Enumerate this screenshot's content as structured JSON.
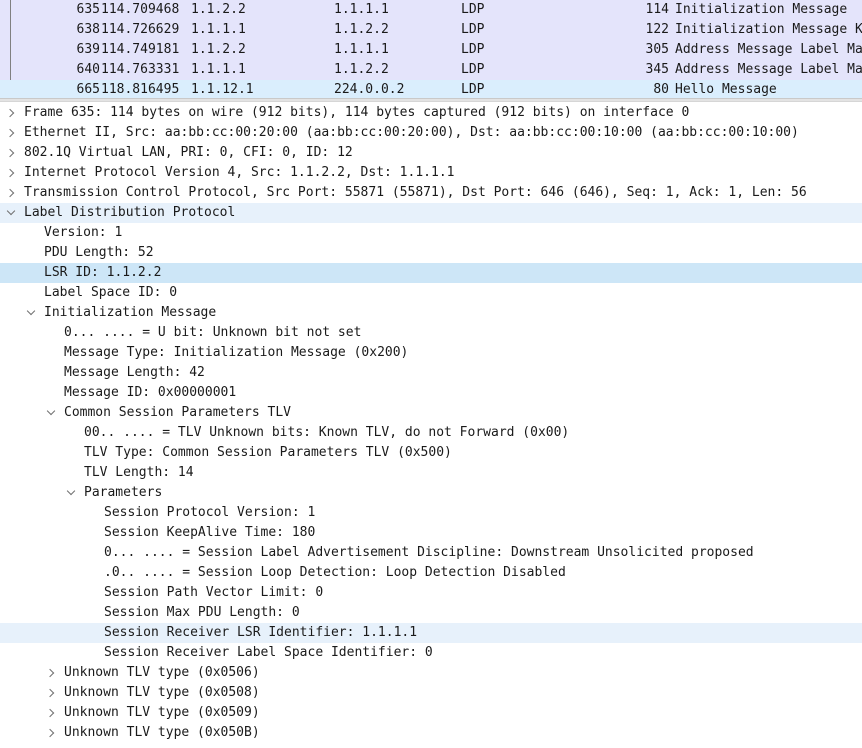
{
  "packet_list": {
    "rows": [
      {
        "no": "635",
        "time": "114.709468",
        "src": "1.1.2.2",
        "dst": "1.1.1.1",
        "proto": "LDP",
        "len": "114",
        "info": "Initialization Message",
        "bg": "#e4e4fb"
      },
      {
        "no": "638",
        "time": "114.726629",
        "src": "1.1.1.1",
        "dst": "1.1.2.2",
        "proto": "LDP",
        "len": "122",
        "info": "Initialization Message K",
        "bg": "#e4e4fb"
      },
      {
        "no": "639",
        "time": "114.749181",
        "src": "1.1.2.2",
        "dst": "1.1.1.1",
        "proto": "LDP",
        "len": "305",
        "info": "Address Message Label Ma",
        "bg": "#e4e4fb"
      },
      {
        "no": "640",
        "time": "114.763331",
        "src": "1.1.1.1",
        "dst": "1.1.2.2",
        "proto": "LDP",
        "len": "345",
        "info": "Address Message Label Ma",
        "bg": "#e4e4fb"
      },
      {
        "no": "665",
        "time": "118.816495",
        "src": "1.1.12.1",
        "dst": "224.0.0.2",
        "proto": "LDP",
        "len": "80",
        "info": "Hello Message",
        "bg": "#daeefd"
      }
    ]
  },
  "details": {
    "rows": [
      {
        "level": 0,
        "state": "collapsed",
        "text": "Frame 635: 114 bytes on wire (912 bits), 114 bytes captured (912 bits) on interface 0"
      },
      {
        "level": 0,
        "state": "collapsed",
        "text": "Ethernet II, Src: aa:bb:cc:00:20:00 (aa:bb:cc:00:20:00), Dst: aa:bb:cc:00:10:00 (aa:bb:cc:00:10:00)"
      },
      {
        "level": 0,
        "state": "collapsed",
        "text": "802.1Q Virtual LAN, PRI: 0, CFI: 0, ID: 12"
      },
      {
        "level": 0,
        "state": "collapsed",
        "text": "Internet Protocol Version 4, Src: 1.1.2.2, Dst: 1.1.1.1"
      },
      {
        "level": 0,
        "state": "collapsed",
        "text": "Transmission Control Protocol, Src Port: 55871 (55871), Dst Port: 646 (646), Seq: 1, Ack: 1, Len: 56"
      },
      {
        "level": 0,
        "state": "expanded",
        "text": "Label Distribution Protocol",
        "highlight": "light"
      },
      {
        "level": 1,
        "state": "leaf",
        "text": "Version: 1"
      },
      {
        "level": 1,
        "state": "leaf",
        "text": "PDU Length: 52"
      },
      {
        "level": 1,
        "state": "leaf",
        "text": "LSR ID: 1.1.2.2",
        "highlight": "dark"
      },
      {
        "level": 1,
        "state": "leaf",
        "text": "Label Space ID: 0"
      },
      {
        "level": 1,
        "state": "expanded",
        "text": "Initialization Message"
      },
      {
        "level": 2,
        "state": "leaf",
        "text": "0... .... = U bit: Unknown bit not set"
      },
      {
        "level": 2,
        "state": "leaf",
        "text": "Message Type: Initialization Message (0x200)"
      },
      {
        "level": 2,
        "state": "leaf",
        "text": "Message Length: 42"
      },
      {
        "level": 2,
        "state": "leaf",
        "text": "Message ID: 0x00000001"
      },
      {
        "level": 2,
        "state": "expanded",
        "text": "Common Session Parameters TLV"
      },
      {
        "level": 3,
        "state": "leaf",
        "text": "00.. .... = TLV Unknown bits: Known TLV, do not Forward (0x00)"
      },
      {
        "level": 3,
        "state": "leaf",
        "text": "TLV Type: Common Session Parameters TLV (0x500)"
      },
      {
        "level": 3,
        "state": "leaf",
        "text": "TLV Length: 14"
      },
      {
        "level": 3,
        "state": "expanded",
        "text": "Parameters"
      },
      {
        "level": 4,
        "state": "leaf",
        "text": "Session Protocol Version: 1"
      },
      {
        "level": 4,
        "state": "leaf",
        "text": "Session KeepAlive Time: 180"
      },
      {
        "level": 4,
        "state": "leaf",
        "text": "0... .... = Session Label Advertisement Discipline: Downstream Unsolicited proposed"
      },
      {
        "level": 4,
        "state": "leaf",
        "text": ".0.. .... = Session Loop Detection: Loop Detection Disabled"
      },
      {
        "level": 4,
        "state": "leaf",
        "text": "Session Path Vector Limit: 0"
      },
      {
        "level": 4,
        "state": "leaf",
        "text": "Session Max PDU Length: 0"
      },
      {
        "level": 4,
        "state": "leaf",
        "text": "Session Receiver LSR Identifier: 1.1.1.1",
        "highlight": "light"
      },
      {
        "level": 4,
        "state": "leaf",
        "text": "Session Receiver Label Space Identifier: 0"
      },
      {
        "level": 2,
        "state": "collapsed",
        "text": "Unknown TLV type (0x0506)"
      },
      {
        "level": 2,
        "state": "collapsed",
        "text": "Unknown TLV type (0x0508)"
      },
      {
        "level": 2,
        "state": "collapsed",
        "text": "Unknown TLV type (0x0509)"
      },
      {
        "level": 2,
        "state": "collapsed",
        "text": "Unknown TLV type (0x050B)"
      }
    ]
  },
  "colors": {
    "ldp_row_bg": "#e4e4fb",
    "hello_row_bg": "#daeefd",
    "selection_dark": "#cde6f7",
    "selection_light": "#e7f1fb"
  }
}
